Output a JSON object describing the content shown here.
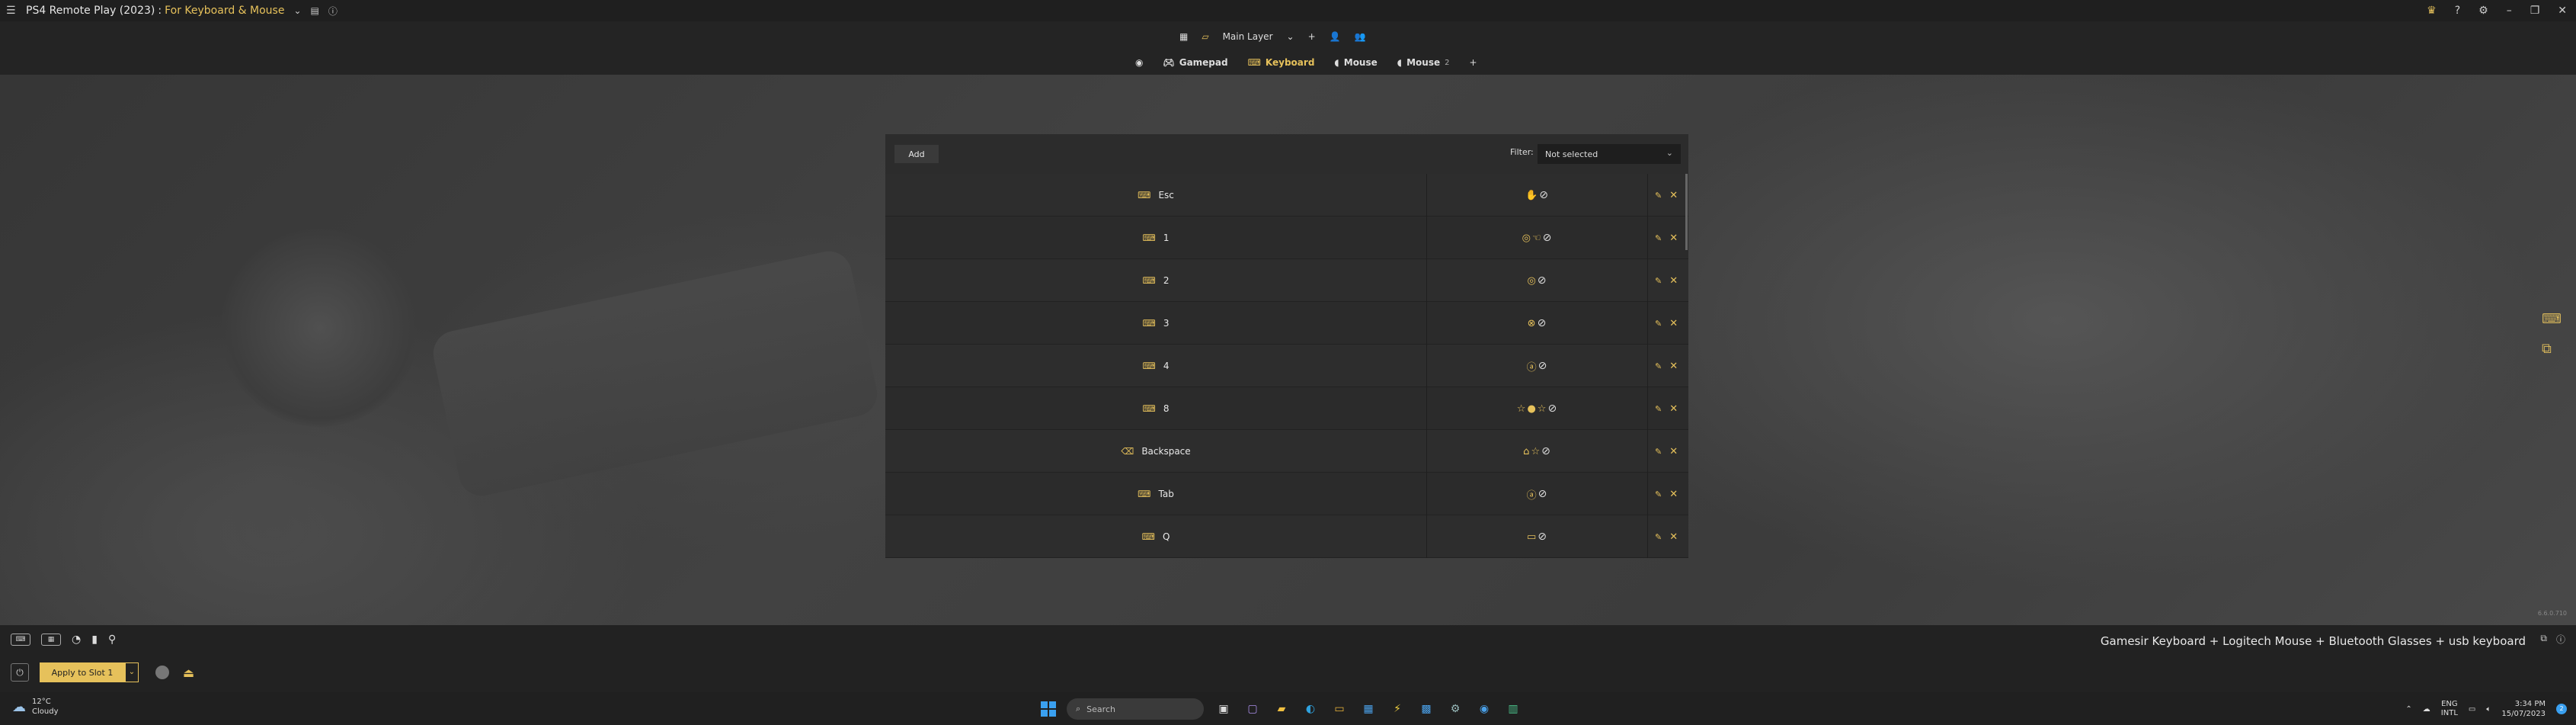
{
  "titlebar": {
    "app_name": "PS4 Remote Play (2023)",
    "separator": ":",
    "config_name": "For Keyboard & Mouse",
    "menu_icon": "hamburger-icon",
    "right_icons": [
      "crown-icon",
      "help-icon",
      "settings-icon",
      "minimize-icon",
      "maximize-icon",
      "close-icon"
    ],
    "minimize_glyph": "–",
    "maximize_glyph": "❐",
    "close_glyph": "✕"
  },
  "layerbar": {
    "layer_name": "Main Layer",
    "add_glyph": "+",
    "tabs": [
      {
        "label": "Gamepad",
        "active": false,
        "icon": "gamepad-icon"
      },
      {
        "label": "Keyboard",
        "active": true,
        "icon": "keyboard-icon"
      },
      {
        "label": "Mouse",
        "active": false,
        "icon": "mouse-icon"
      },
      {
        "label": "Mouse",
        "sub": "2",
        "active": false,
        "icon": "mouse-icon"
      }
    ]
  },
  "panel": {
    "add_label": "Add",
    "filter_label": "Filter:",
    "filter_value": "Not selected",
    "rows": [
      {
        "key": "Esc",
        "key_icon": "keyboard-icon",
        "targets": [
          "✋"
        ]
      },
      {
        "key": "1",
        "key_icon": "keyboard-icon",
        "targets": [
          "◎",
          "☜"
        ]
      },
      {
        "key": "2",
        "key_icon": "keyboard-icon",
        "targets": [
          "◎"
        ]
      },
      {
        "key": "3",
        "key_icon": "keyboard-icon",
        "targets": [
          "⊗"
        ]
      },
      {
        "key": "4",
        "key_icon": "keyboard-icon",
        "targets": [
          "ⓐ"
        ]
      },
      {
        "key": "8",
        "key_icon": "keyboard-icon",
        "targets": [
          "☆",
          "●",
          "☆"
        ]
      },
      {
        "key": "Backspace",
        "key_icon": "backspace-icon",
        "targets": [
          "⌂",
          "☆"
        ]
      },
      {
        "key": "Tab",
        "key_icon": "keyboard-icon",
        "targets": [
          "ⓐ"
        ]
      },
      {
        "key": "Q",
        "key_icon": "keyboard-icon",
        "targets": [
          "▭"
        ]
      }
    ],
    "none_glyph": "⊘",
    "edit_glyph": "✎",
    "delete_glyph": "✕"
  },
  "version": "6.6.0.710",
  "bottombar": {
    "devices": "Gamesir Keyboard + Logitech Mouse + Bluetooth Glasses + usb keyboard",
    "apply_label": "Apply to Slot 1"
  },
  "taskbar": {
    "weather_temp": "12°C",
    "weather_desc": "Cloudy",
    "search_placeholder": "Search",
    "lang1": "ENG",
    "lang2": "INTL",
    "time": "3:34 PM",
    "date": "15/07/2023",
    "notification_count": "2"
  },
  "colors": {
    "accent": "#e6c15b",
    "titlebar_bg": "#1f1f1f",
    "panel_bg": "#2d2d2d"
  }
}
